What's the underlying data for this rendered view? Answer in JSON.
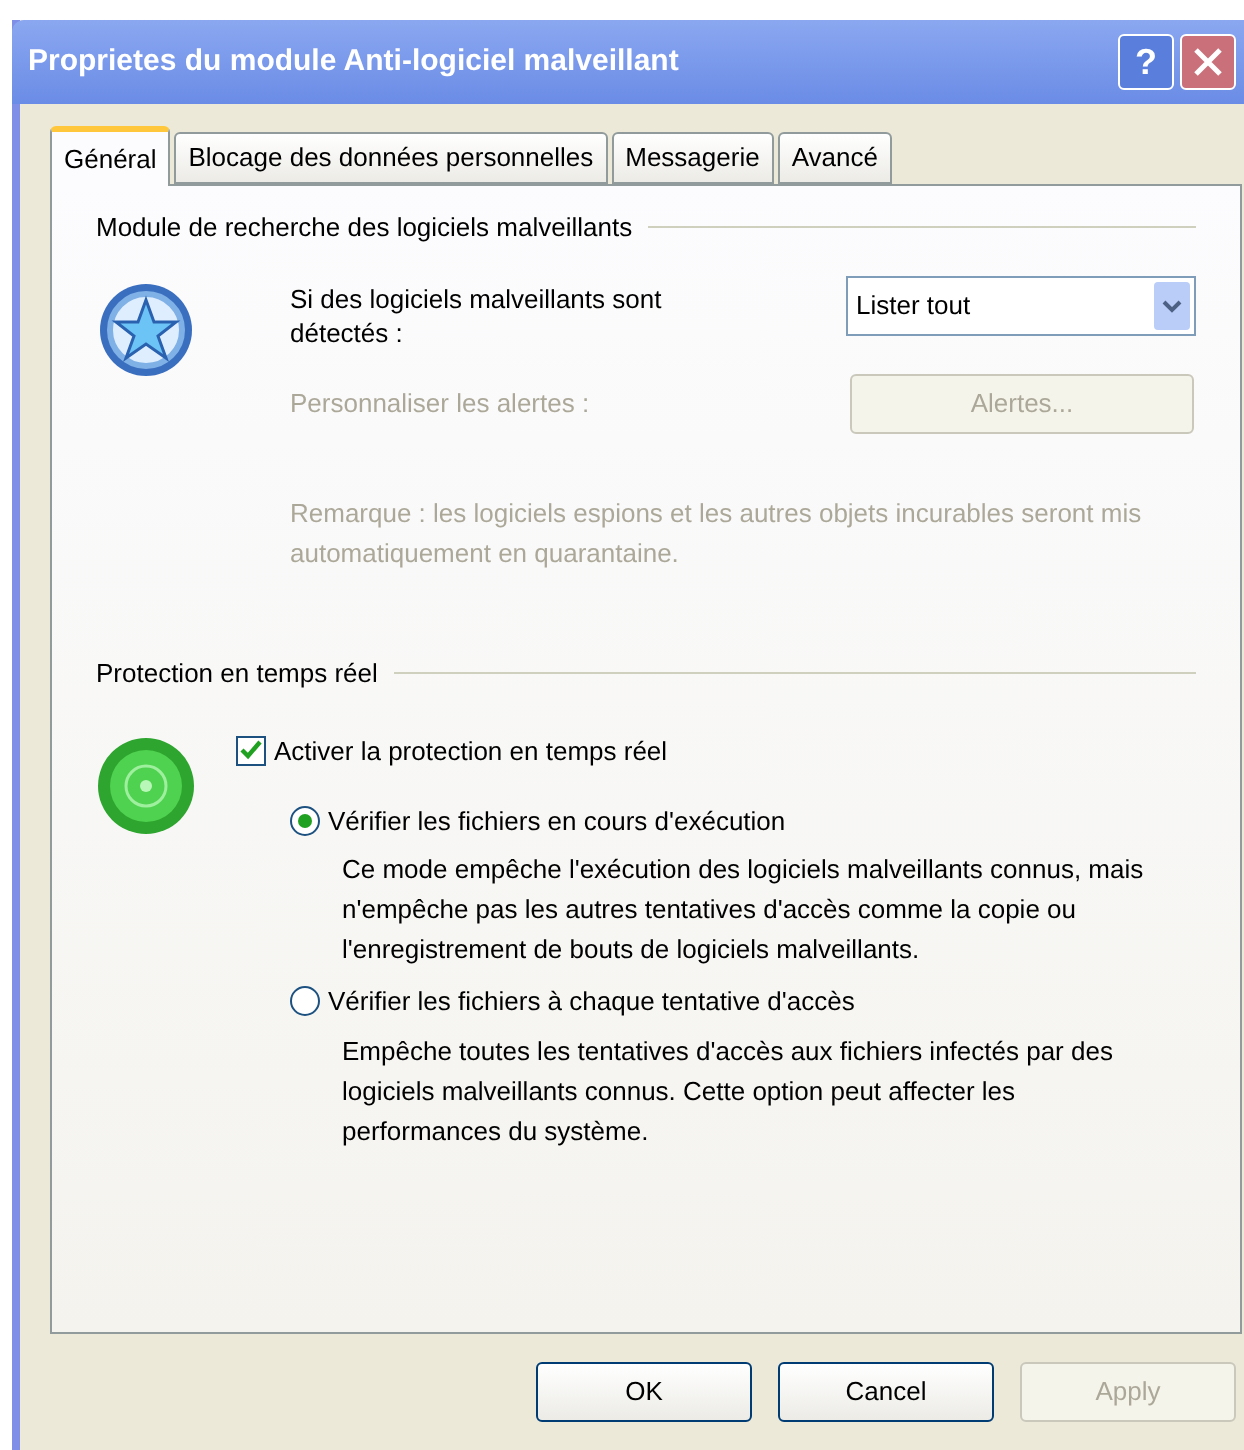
{
  "window": {
    "title": "Proprietes du module Anti-logiciel malveillant",
    "help": "?"
  },
  "tabs": [
    {
      "label": "Général",
      "selected": true
    },
    {
      "label": "Blocage des données personnelles",
      "selected": false
    },
    {
      "label": "Messagerie",
      "selected": false
    },
    {
      "label": "Avancé",
      "selected": false
    }
  ],
  "scanner": {
    "heading": "Module de recherche des logiciels malveillants",
    "action_label": "Si des logiciels malveillants sont détectés :",
    "action_value": "Lister tout",
    "alerts_label": "Personnaliser les alertes :",
    "alerts_button": {
      "label": "Alertes...",
      "disabled": true
    },
    "note": "Remarque : les logiciels espions et les autres objets incurables seront mis automatiquement en quarantaine.",
    "note_disabled": true
  },
  "realtime": {
    "heading": "Protection en temps réel",
    "enable": {
      "label": "Activer la protection en temps réel",
      "checked": true
    },
    "options": [
      {
        "label": "Vérifier les fichiers en cours d'exécution",
        "selected": true,
        "description": "Ce mode empêche l'exécution des logiciels malveillants connus, mais n'empêche pas les autres tentatives d'accès comme la copie ou l'enregistrement de bouts de logiciels malveillants."
      },
      {
        "label": "Vérifier les fichiers à chaque tentative d'accès",
        "selected": false,
        "description": "Empêche toutes les tentatives d'accès aux fichiers infectés par des logiciels malveillants connus. Cette option peut affecter les performances du système."
      }
    ]
  },
  "buttons": [
    {
      "label": "OK",
      "disabled": false
    },
    {
      "label": "Cancel",
      "disabled": false
    },
    {
      "label": "Apply",
      "disabled": true
    }
  ]
}
